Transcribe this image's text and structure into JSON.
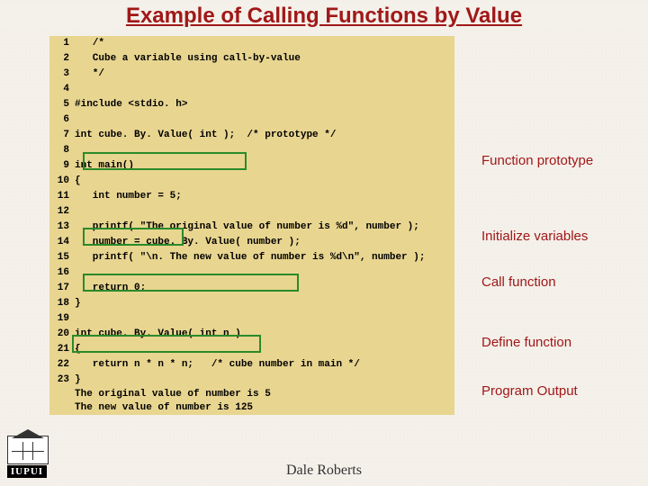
{
  "title": "Example of Calling Functions by Value",
  "code": {
    "lines": [
      {
        "n": "1",
        "t": "   /*"
      },
      {
        "n": "2",
        "t": "   Cube a variable using call-by-value"
      },
      {
        "n": "3",
        "t": "   */"
      },
      {
        "n": "4",
        "t": ""
      },
      {
        "n": "5",
        "t": "#include <stdio. h>"
      },
      {
        "n": "6",
        "t": ""
      },
      {
        "n": "7",
        "t": "int cube. By. Value( int );  /* prototype */"
      },
      {
        "n": "8",
        "t": ""
      },
      {
        "n": "9",
        "t": "int main()"
      },
      {
        "n": "10",
        "t": "{"
      },
      {
        "n": "11",
        "t": "   int number = 5;"
      },
      {
        "n": "12",
        "t": ""
      },
      {
        "n": "13",
        "t": "   printf( \"The original value of number is %d\", number );"
      },
      {
        "n": "14",
        "t": "   number = cube. By. Value( number );"
      },
      {
        "n": "15",
        "t": "   printf( \"\\n. The new value of number is %d\\n\", number );"
      },
      {
        "n": "16",
        "t": ""
      },
      {
        "n": "17",
        "t": "   return 0;"
      },
      {
        "n": "18",
        "t": "}"
      },
      {
        "n": "19",
        "t": ""
      },
      {
        "n": "20",
        "t": "int cube. By. Value( int n )"
      },
      {
        "n": "21",
        "t": "{"
      },
      {
        "n": "22",
        "t": "   return n * n * n;   /* cube number in main */"
      },
      {
        "n": "23",
        "t": "}"
      }
    ],
    "output1": "The original value of number is 5",
    "output2": "The new value of number is 125"
  },
  "annotations": {
    "a1": "Function prototype",
    "a2": "Initialize variables",
    "a3": "Call function",
    "a4": "Define function",
    "a5": "Program Output"
  },
  "footer": "Dale Roberts",
  "logo_text": "IUPUI"
}
